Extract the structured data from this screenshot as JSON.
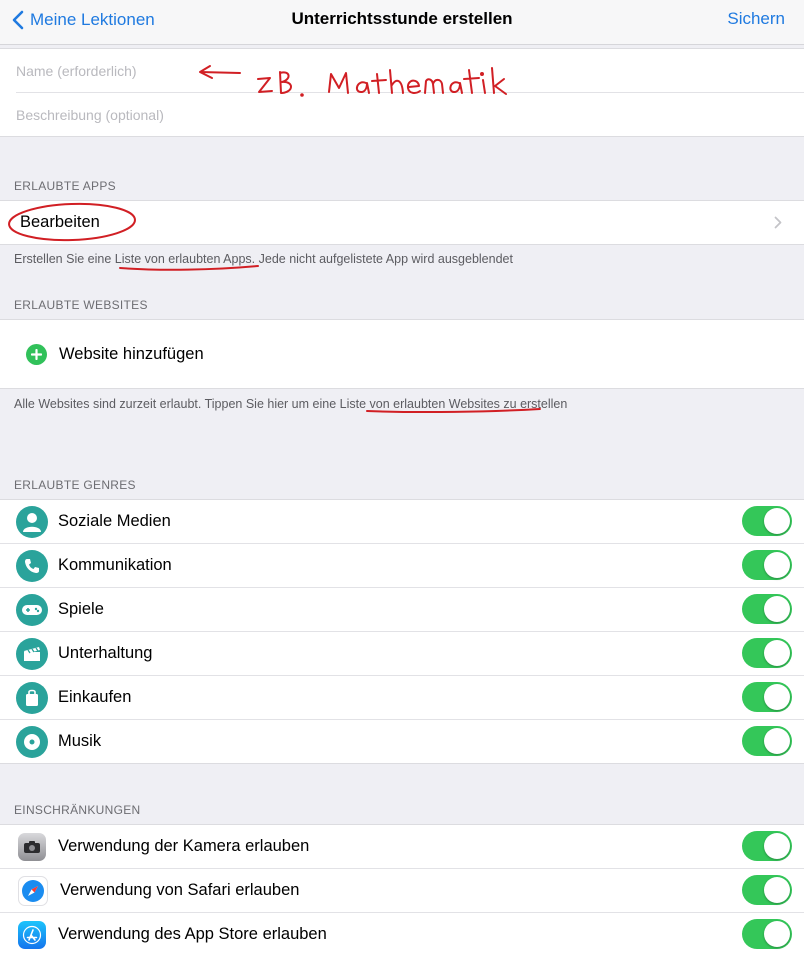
{
  "navbar": {
    "back_label": "Meine Lektionen",
    "title": "Unterrichtsstunde erstellen",
    "save_label": "Sichern"
  },
  "form": {
    "name_placeholder": "Name (erforderlich)",
    "description_placeholder": "Beschreibung (optional)"
  },
  "annotation": {
    "handwritten_note": "z.B. Mathematik"
  },
  "allowed_apps": {
    "header": "ERLAUBTE APPS",
    "edit_label": "Bearbeiten",
    "footer_before": "Erstellen Sie eine ",
    "footer_link": "Liste von erlaubten Apps",
    "footer_after": ". Jede nicht aufgelistete App wird ausgeblendet"
  },
  "allowed_websites": {
    "header": "ERLAUBTE WEBSITES",
    "add_label": "Website hinzufügen",
    "footer_before": "Alle Websites sind zurzeit erlaubt. Tippen Sie hier um eine ",
    "footer_link": "Liste von erlaubten Websites",
    "footer_after": " zu erstellen"
  },
  "genres": {
    "header": "ERLAUBTE GENRES",
    "items": [
      {
        "label": "Soziale Medien",
        "icon": "person-icon",
        "enabled": true
      },
      {
        "label": "Kommunikation",
        "icon": "phone-icon",
        "enabled": true
      },
      {
        "label": "Spiele",
        "icon": "gamepad-icon",
        "enabled": true
      },
      {
        "label": "Unterhaltung",
        "icon": "clapperboard-icon",
        "enabled": true
      },
      {
        "label": "Einkaufen",
        "icon": "shopping-bag-icon",
        "enabled": true
      },
      {
        "label": "Musik",
        "icon": "music-disc-icon",
        "enabled": true
      }
    ]
  },
  "restrictions": {
    "header": "EINSCHRÄNKUNGEN",
    "items": [
      {
        "label": "Verwendung der Kamera erlauben",
        "icon": "camera-app-icon",
        "enabled": true
      },
      {
        "label": "Verwendung von Safari erlauben",
        "icon": "safari-app-icon",
        "enabled": true
      },
      {
        "label": "Verwendung des App Store erlauben",
        "icon": "app-store-icon",
        "enabled": true
      }
    ]
  },
  "colors": {
    "accent": "#1f7ae0",
    "toggle_on": "#34c759",
    "genre_icon": "#2aa39b",
    "annotation_ink": "#d11f24"
  }
}
